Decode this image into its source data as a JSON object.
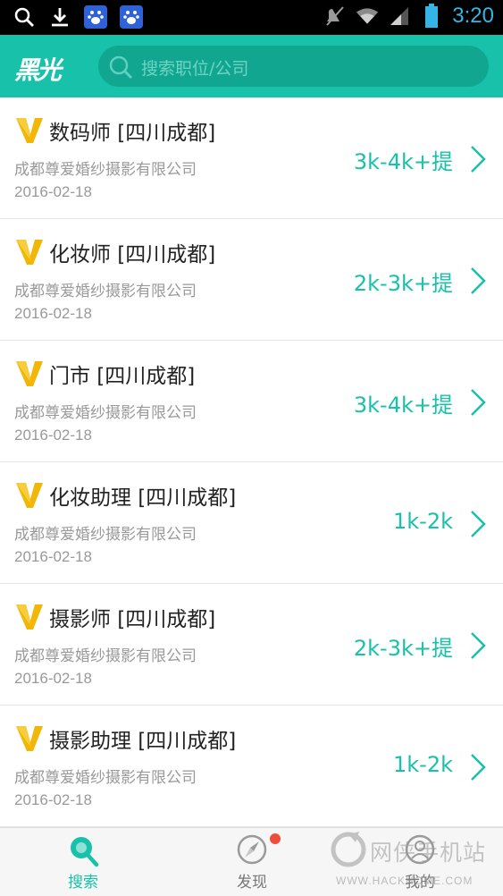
{
  "status_bar": {
    "time": "3:20",
    "icons": [
      "search-icon",
      "download-icon",
      "baidu-icon",
      "baidu-icon",
      "mute-icon",
      "wifi-icon",
      "signal-icon",
      "battery-icon"
    ]
  },
  "header": {
    "logo": "黑光",
    "search_placeholder": "搜索职位/公司"
  },
  "jobs": [
    {
      "title": "数码师 [四川成都]",
      "company": "成都尊爱婚纱摄影有限公司",
      "date": "2016-02-18",
      "salary": "3k-4k+提"
    },
    {
      "title": "化妆师 [四川成都]",
      "company": "成都尊爱婚纱摄影有限公司",
      "date": "2016-02-18",
      "salary": "2k-3k+提"
    },
    {
      "title": "门市 [四川成都]",
      "company": "成都尊爱婚纱摄影有限公司",
      "date": "2016-02-18",
      "salary": "3k-4k+提"
    },
    {
      "title": "化妆助理 [四川成都]",
      "company": "成都尊爱婚纱摄影有限公司",
      "date": "2016-02-18",
      "salary": "1k-2k"
    },
    {
      "title": "摄影师 [四川成都]",
      "company": "成都尊爱婚纱摄影有限公司",
      "date": "2016-02-18",
      "salary": "2k-3k+提"
    },
    {
      "title": "摄影助理 [四川成都]",
      "company": "成都尊爱婚纱摄影有限公司",
      "date": "2016-02-18",
      "salary": "1k-2k"
    }
  ],
  "bottom_nav": {
    "tabs": [
      {
        "label": "搜索",
        "icon": "search-icon",
        "active": true
      },
      {
        "label": "发现",
        "icon": "compass-icon",
        "active": false,
        "badge": true
      },
      {
        "label": "我的",
        "icon": "profile-icon",
        "active": false
      }
    ]
  },
  "watermark": {
    "text": "网侠手机站",
    "url": "WWW.HACKHOME.COM"
  },
  "colors": {
    "accent": "#18c1a9",
    "badge": "#ef4d3c",
    "v_badge": "#f2b705"
  }
}
